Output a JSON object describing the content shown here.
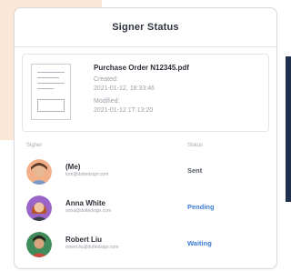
{
  "header": {
    "title": "Signer Status"
  },
  "document": {
    "name": "Purchase Order N12345.pdf",
    "created_label": "Created:",
    "created_value": "2021-01-12, 18:33:46",
    "modified_label": "Modified:",
    "modified_value": "2021-01-12 1T 13:20"
  },
  "columns": {
    "signer": "Signer",
    "status": "Status"
  },
  "signers": [
    {
      "name": "(Me)",
      "email": "tom@dottedsign.com",
      "status": "Sent"
    },
    {
      "name": "Anna White",
      "email": "anna@dottedsign.com",
      "status": "Pending"
    },
    {
      "name": "Robert Liu",
      "email": "robert.liu@dottedsign.com",
      "status": "Waiting"
    }
  ],
  "colors": {
    "sent": "#555b63",
    "pending": "#3b7bd4",
    "waiting": "#3b7bd4",
    "background_block": "#fbe7d6",
    "accent_strip": "#20314f"
  }
}
